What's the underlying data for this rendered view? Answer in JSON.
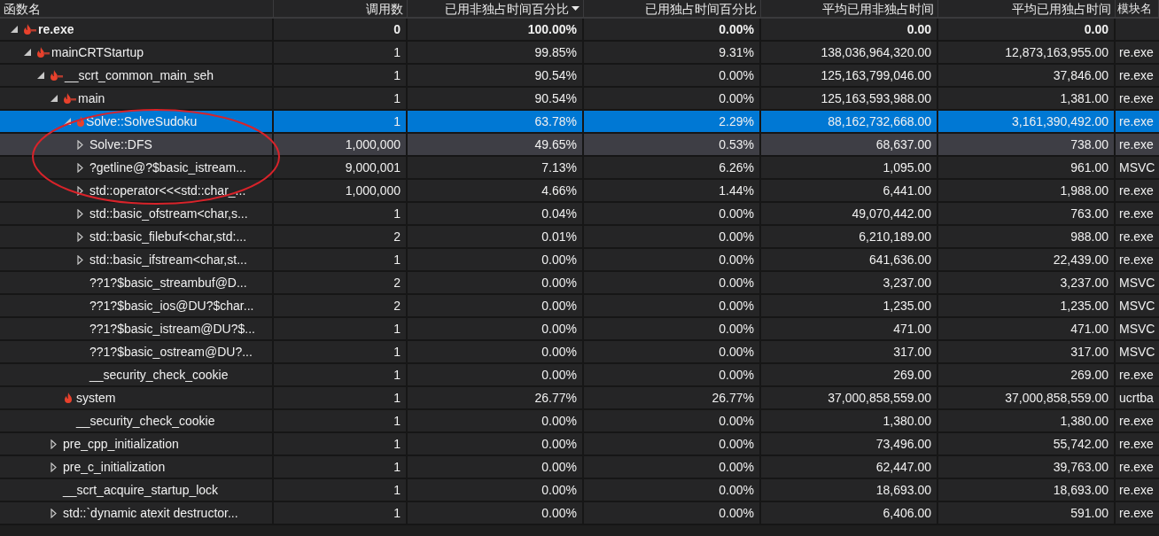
{
  "table": {
    "columns": [
      {
        "label": "函数名",
        "sorted": false
      },
      {
        "label": "调用数",
        "sorted": false
      },
      {
        "label": "已用非独占时间百分比",
        "sorted": true
      },
      {
        "label": "已用独占时间百分比",
        "sorted": false
      },
      {
        "label": "平均已用非独占时间",
        "sorted": false
      },
      {
        "label": "平均已用独占时间",
        "sorted": false
      },
      {
        "label": "模块名",
        "sorted": false
      }
    ],
    "rows": [
      {
        "kind": "expanded",
        "hot_path": true,
        "hot_spot": false,
        "bold": true,
        "selected": false,
        "highlighted": false,
        "cells": [
          "re.exe",
          "0",
          "100.00%",
          "0.00%",
          "0.00",
          "0.00",
          ""
        ],
        "children": [
          {
            "kind": "expanded",
            "hot_path": true,
            "hot_spot": false,
            "bold": false,
            "selected": false,
            "highlighted": false,
            "cells": [
              "mainCRTStartup",
              "1",
              "99.85%",
              "9.31%",
              "138,036,964,320.00",
              "12,873,163,955.00",
              "re.exe"
            ],
            "children": [
              {
                "kind": "expanded",
                "hot_path": true,
                "hot_spot": false,
                "bold": false,
                "selected": false,
                "highlighted": false,
                "cells": [
                  "__scrt_common_main_seh",
                  "1",
                  "90.54%",
                  "0.00%",
                  "125,163,799,046.00",
                  "37,846.00",
                  "re.exe"
                ],
                "children": [
                  {
                    "kind": "expanded",
                    "hot_path": true,
                    "hot_spot": false,
                    "bold": false,
                    "selected": false,
                    "highlighted": false,
                    "cells": [
                      "main",
                      "1",
                      "90.54%",
                      "0.00%",
                      "125,163,593,988.00",
                      "1,381.00",
                      "re.exe"
                    ],
                    "children": [
                      {
                        "kind": "expanded",
                        "hot_path": false,
                        "hot_spot": true,
                        "bold": false,
                        "selected": true,
                        "highlighted": false,
                        "cells": [
                          "Solve::SolveSudoku",
                          "1",
                          "63.78%",
                          "2.29%",
                          "88,162,732,668.00",
                          "3,161,390,492.00",
                          "re.exe"
                        ],
                        "children": [
                          {
                            "kind": "collapsed",
                            "hot_path": false,
                            "hot_spot": false,
                            "bold": false,
                            "selected": false,
                            "highlighted": true,
                            "cells": [
                              "Solve::DFS",
                              "1,000,000",
                              "49.65%",
                              "0.53%",
                              "68,637.00",
                              "738.00",
                              "re.exe"
                            ]
                          },
                          {
                            "kind": "collapsed",
                            "hot_path": false,
                            "hot_spot": false,
                            "bold": false,
                            "selected": false,
                            "highlighted": false,
                            "cells": [
                              "?getline@?$basic_istream...",
                              "9,000,001",
                              "7.13%",
                              "6.26%",
                              "1,095.00",
                              "961.00",
                              "MSVC"
                            ]
                          },
                          {
                            "kind": "collapsed",
                            "hot_path": false,
                            "hot_spot": false,
                            "bold": false,
                            "selected": false,
                            "highlighted": false,
                            "cells": [
                              "std::operator<<<std::char_...",
                              "1,000,000",
                              "4.66%",
                              "1.44%",
                              "6,441.00",
                              "1,988.00",
                              "re.exe"
                            ]
                          },
                          {
                            "kind": "collapsed",
                            "hot_path": false,
                            "hot_spot": false,
                            "bold": false,
                            "selected": false,
                            "highlighted": false,
                            "cells": [
                              "std::basic_ofstream<char,s...",
                              "1",
                              "0.04%",
                              "0.00%",
                              "49,070,442.00",
                              "763.00",
                              "re.exe"
                            ]
                          },
                          {
                            "kind": "collapsed",
                            "hot_path": false,
                            "hot_spot": false,
                            "bold": false,
                            "selected": false,
                            "highlighted": false,
                            "cells": [
                              "std::basic_filebuf<char,std:...",
                              "2",
                              "0.01%",
                              "0.00%",
                              "6,210,189.00",
                              "988.00",
                              "re.exe"
                            ]
                          },
                          {
                            "kind": "collapsed",
                            "hot_path": false,
                            "hot_spot": false,
                            "bold": false,
                            "selected": false,
                            "highlighted": false,
                            "cells": [
                              "std::basic_ifstream<char,st...",
                              "1",
                              "0.00%",
                              "0.00%",
                              "641,636.00",
                              "22,439.00",
                              "re.exe"
                            ]
                          },
                          {
                            "kind": "leaf",
                            "hot_path": false,
                            "hot_spot": false,
                            "bold": false,
                            "selected": false,
                            "highlighted": false,
                            "cells": [
                              "??1?$basic_streambuf@D...",
                              "2",
                              "0.00%",
                              "0.00%",
                              "3,237.00",
                              "3,237.00",
                              "MSVC"
                            ]
                          },
                          {
                            "kind": "leaf",
                            "hot_path": false,
                            "hot_spot": false,
                            "bold": false,
                            "selected": false,
                            "highlighted": false,
                            "cells": [
                              "??1?$basic_ios@DU?$char...",
                              "2",
                              "0.00%",
                              "0.00%",
                              "1,235.00",
                              "1,235.00",
                              "MSVC"
                            ]
                          },
                          {
                            "kind": "leaf",
                            "hot_path": false,
                            "hot_spot": false,
                            "bold": false,
                            "selected": false,
                            "highlighted": false,
                            "cells": [
                              "??1?$basic_istream@DU?$...",
                              "1",
                              "0.00%",
                              "0.00%",
                              "471.00",
                              "471.00",
                              "MSVC"
                            ]
                          },
                          {
                            "kind": "leaf",
                            "hot_path": false,
                            "hot_spot": false,
                            "bold": false,
                            "selected": false,
                            "highlighted": false,
                            "cells": [
                              "??1?$basic_ostream@DU?...",
                              "1",
                              "0.00%",
                              "0.00%",
                              "317.00",
                              "317.00",
                              "MSVC"
                            ]
                          },
                          {
                            "kind": "leaf",
                            "hot_path": false,
                            "hot_spot": false,
                            "bold": false,
                            "selected": false,
                            "highlighted": false,
                            "cells": [
                              "__security_check_cookie",
                              "1",
                              "0.00%",
                              "0.00%",
                              "269.00",
                              "269.00",
                              "re.exe"
                            ]
                          }
                        ]
                      },
                      {
                        "kind": "leaf",
                        "hot_path": false,
                        "hot_spot": true,
                        "bold": false,
                        "selected": false,
                        "highlighted": false,
                        "cells": [
                          "system",
                          "1",
                          "26.77%",
                          "26.77%",
                          "37,000,858,559.00",
                          "37,000,858,559.00",
                          "ucrtba"
                        ]
                      },
                      {
                        "kind": "leaf",
                        "hot_path": false,
                        "hot_spot": false,
                        "bold": false,
                        "selected": false,
                        "highlighted": false,
                        "cells": [
                          "__security_check_cookie",
                          "1",
                          "0.00%",
                          "0.00%",
                          "1,380.00",
                          "1,380.00",
                          "re.exe"
                        ]
                      }
                    ]
                  },
                  {
                    "kind": "collapsed",
                    "hot_path": false,
                    "hot_spot": false,
                    "bold": false,
                    "selected": false,
                    "highlighted": false,
                    "cells": [
                      "pre_cpp_initialization",
                      "1",
                      "0.00%",
                      "0.00%",
                      "73,496.00",
                      "55,742.00",
                      "re.exe"
                    ]
                  },
                  {
                    "kind": "collapsed",
                    "hot_path": false,
                    "hot_spot": false,
                    "bold": false,
                    "selected": false,
                    "highlighted": false,
                    "cells": [
                      "pre_c_initialization",
                      "1",
                      "0.00%",
                      "0.00%",
                      "62,447.00",
                      "39,763.00",
                      "re.exe"
                    ]
                  },
                  {
                    "kind": "leaf",
                    "hot_path": false,
                    "hot_spot": false,
                    "bold": false,
                    "selected": false,
                    "highlighted": false,
                    "cells": [
                      "__scrt_acquire_startup_lock",
                      "1",
                      "0.00%",
                      "0.00%",
                      "18,693.00",
                      "18,693.00",
                      "re.exe"
                    ]
                  },
                  {
                    "kind": "collapsed",
                    "hot_path": false,
                    "hot_spot": false,
                    "bold": false,
                    "selected": false,
                    "highlighted": false,
                    "cells": [
                      "std::`dynamic atexit destructor...",
                      "1",
                      "0.00%",
                      "0.00%",
                      "6,406.00",
                      "591.00",
                      "re.exe"
                    ]
                  }
                ]
              }
            ]
          }
        ]
      }
    ]
  },
  "annotation": {
    "kind": "ellipse"
  }
}
